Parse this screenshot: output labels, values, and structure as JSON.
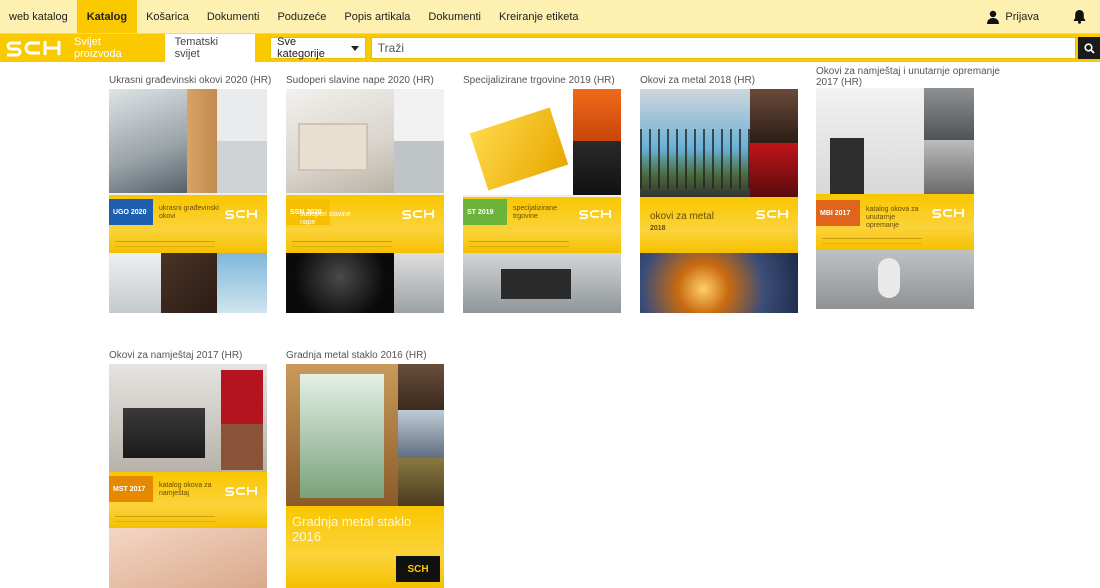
{
  "topnav": {
    "items": [
      "web katalog",
      "Katalog",
      "Košarica",
      "Dokumenti",
      "Poduzeće",
      "Popis artikala",
      "Dokumenti",
      "Kreiranje etiketa"
    ],
    "active_index": 1,
    "login_label": "Prijava"
  },
  "subbar": {
    "tabs": [
      "Svijet proizvoda",
      "Tematski svijet"
    ],
    "active_index": 1,
    "category_label": "Sve kategorije",
    "search_placeholder": "Traži"
  },
  "colors": {
    "brand_yellow": "#fbc900",
    "nav_bg": "#fdf0b0"
  },
  "catalogs": [
    {
      "title": "Ukrasni građevinski okovi 2020 (HR)",
      "tag": "UGO 2020",
      "tag_color": "#1f5fb0",
      "cover_text": "ukrasni građevinski okovi"
    },
    {
      "title": "Sudoperi slavine nape 2020 (HR)",
      "tag": "SSN 2020",
      "tag_color": "#f6c000",
      "cover_text": "sudoperi slavine nape"
    },
    {
      "title": "Specijalizirane trgovine 2019 (HR)",
      "tag": "ST 2019",
      "tag_color": "#6bb33a",
      "cover_text": "specijalizirane trgovine"
    },
    {
      "title": "Okovi za metal 2018 (HR)",
      "tag": "2018",
      "tag_color": "#f6c000",
      "cover_text": "okovi za metal"
    },
    {
      "title": "Okovi za namještaj i unutarnje opremanje 2017 (HR)",
      "tag": "MBI 2017",
      "tag_color": "#e0651a",
      "cover_text": "katalog okova za unutarnje opremanje"
    },
    {
      "title": "Okovi za namještaj 2017 (HR)",
      "tag": "MST 2017",
      "tag_color": "#e58a00",
      "cover_text": "katalog okova za namještaj"
    },
    {
      "title": "Gradnja metal staklo 2016 (HR)",
      "tag": "",
      "tag_color": "#f6c000",
      "cover_text": "Gradnja metal staklo 2016"
    }
  ],
  "icons": {
    "user": "user-icon",
    "bell": "bell-icon",
    "search": "search-icon",
    "logo": "sch-logo"
  }
}
